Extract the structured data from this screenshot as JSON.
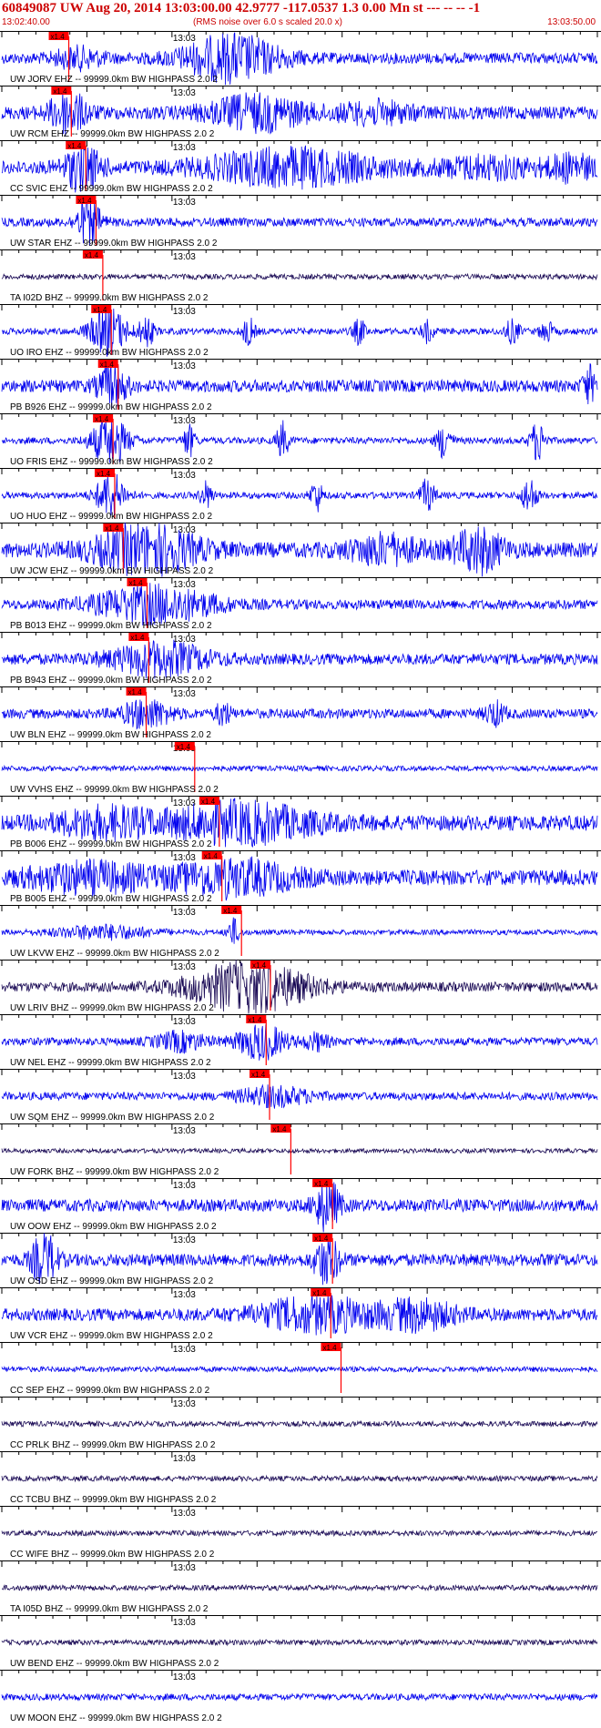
{
  "header": {
    "title": "60849087 UW Aug 20, 2014 13:03:00.00   42.9777 -117.0537  1.3 0.00 Mn st --- -- --   -1",
    "start_time": "13:02:40.00",
    "note": "(RMS noise over 6.0 s scaled 20.0 x)",
    "end_time": "13:03:50.00"
  },
  "colors": {
    "trace": "#0000ee",
    "trace_dark": "#1a0a55",
    "pick": "#ff0000",
    "label": "#000000",
    "header": "#cc0000"
  },
  "chart_data": {
    "type": "line",
    "title": "60849087 UW Aug 20, 2014 13:03:00.00   42.9777 -117.0537  1.3 0.00 Mn st --- -- --   -1",
    "x_start": "13:02:40.00",
    "x_end": "13:03:50.00",
    "xlim": [
      0,
      70
    ],
    "minute_mark": {
      "label": "13:03",
      "t": 20
    },
    "pick_label": "x1.4",
    "series": [
      {
        "name": "UW JORV EHZ -- 99999.0km BW  HIGHPASS  2.0  2",
        "pick": 6.8,
        "amp": 0.25,
        "dark": false,
        "bursts": [
          [
            27,
            4,
            1.0
          ],
          [
            9,
            2,
            0.4
          ]
        ]
      },
      {
        "name": "UW RCM EHZ -- 99999.0km BW  HIGHPASS  2.0  2",
        "pick": 7.1,
        "amp": 0.3,
        "dark": false,
        "bursts": [
          [
            7.8,
            1.5,
            0.9
          ],
          [
            30,
            4,
            0.7
          ],
          [
            44,
            3,
            0.4
          ]
        ]
      },
      {
        "name": "CC SVIC EHZ -- 99999.0km BW  HIGHPASS  2.0  2",
        "pick": 8.8,
        "amp": 0.3,
        "dark": false,
        "bursts": [
          [
            9.5,
            1.5,
            1.0
          ],
          [
            34,
            7,
            0.75
          ],
          [
            57,
            4,
            0.4
          ],
          [
            67,
            2,
            0.5
          ]
        ]
      },
      {
        "name": "UW STAR EHZ -- 99999.0km BW  HIGHPASS  2.0  2",
        "pick": 10.0,
        "amp": 0.2,
        "dark": false,
        "bursts": [
          [
            10.2,
            1.0,
            1.0
          ]
        ]
      },
      {
        "name": "TA I02D BHZ -- 99999.0km BW  HIGHPASS  2.0  2",
        "pick": 10.8,
        "amp": 0.12,
        "dark": true,
        "bursts": []
      },
      {
        "name": "UO IRO EHZ -- 99999.0km BW  HIGHPASS  2.0  2",
        "pick": 11.8,
        "amp": 0.15,
        "dark": false,
        "bursts": [
          [
            12.5,
            1.5,
            1.1
          ],
          [
            17,
            0.6,
            0.7
          ],
          [
            29,
            0.5,
            0.6
          ],
          [
            42,
            0.5,
            0.55
          ],
          [
            50,
            0.5,
            0.45
          ],
          [
            60,
            0.6,
            0.5
          ],
          [
            64,
            0.5,
            0.5
          ]
        ]
      },
      {
        "name": "PB B926 EHZ -- 99999.0km BW  HIGHPASS  2.0  2",
        "pick": 12.6,
        "amp": 0.28,
        "dark": false,
        "bursts": [
          [
            13.0,
            1.2,
            0.9
          ],
          [
            69,
            0.5,
            0.8
          ]
        ]
      },
      {
        "name": "UO FRIS EHZ -- 99999.0km BW  HIGHPASS  2.0  2",
        "pick": 12.0,
        "amp": 0.15,
        "dark": false,
        "bursts": [
          [
            12.7,
            1.5,
            1.1
          ],
          [
            22,
            0.5,
            0.7
          ],
          [
            33,
            0.5,
            0.8
          ],
          [
            52,
            0.6,
            0.8
          ],
          [
            63,
            0.6,
            0.9
          ]
        ]
      },
      {
        "name": "UO HUO EHZ -- 99999.0km BW  HIGHPASS  2.0  2",
        "pick": 12.2,
        "amp": 0.15,
        "dark": false,
        "bursts": [
          [
            12.8,
            1.2,
            1.0
          ],
          [
            24,
            0.5,
            0.6
          ],
          [
            37,
            0.5,
            0.7
          ],
          [
            50,
            0.6,
            0.7
          ],
          [
            62,
            0.6,
            0.8
          ]
        ]
      },
      {
        "name": "UW JCW EHZ -- 99999.0km BW  HIGHPASS  2.0  2",
        "pick": 13.2,
        "amp": 0.35,
        "dark": false,
        "bursts": [
          [
            17,
            4,
            1.1
          ],
          [
            45,
            3,
            0.55
          ],
          [
            56,
            2,
            0.9
          ]
        ]
      },
      {
        "name": "PB B013 EHZ -- 99999.0km BW  HIGHPASS  2.0  2",
        "pick": 16.0,
        "amp": 0.22,
        "dark": false,
        "bursts": [
          [
            18,
            5,
            0.8
          ]
        ]
      },
      {
        "name": "PB B943 EHZ -- 99999.0km BW  HIGHPASS  2.0  2",
        "pick": 16.2,
        "amp": 0.25,
        "dark": false,
        "bursts": [
          [
            18.5,
            4,
            0.7
          ]
        ]
      },
      {
        "name": "UW BLN EHZ -- 99999.0km BW  HIGHPASS  2.0  2",
        "pick": 15.9,
        "amp": 0.22,
        "dark": false,
        "bursts": [
          [
            17,
            2,
            0.6
          ],
          [
            26,
            0.6,
            0.5
          ],
          [
            58,
            0.8,
            0.5
          ]
        ]
      },
      {
        "name": "UW VVHS EHZ -- 99999.0km BW  HIGHPASS  2.0  2",
        "pick": 21.6,
        "amp": 0.12,
        "dark": false,
        "bursts": []
      },
      {
        "name": "PB B006 EHZ -- 99999.0km BW  HIGHPASS  2.0  2",
        "pick": 24.5,
        "amp": 0.35,
        "dark": false,
        "bursts": [
          [
            28,
            6,
            0.8
          ],
          [
            12,
            4,
            0.55
          ]
        ]
      },
      {
        "name": "PB B005 EHZ -- 99999.0km BW  HIGHPASS  2.0  2",
        "pick": 24.8,
        "amp": 0.35,
        "dark": false,
        "bursts": [
          [
            27,
            5,
            0.7
          ],
          [
            10,
            5,
            0.55
          ]
        ]
      },
      {
        "name": "UW LKVW EHZ -- 99999.0km BW  HIGHPASS  2.0  2",
        "pick": 27.1,
        "amp": 0.12,
        "dark": false,
        "bursts": [
          [
            27.2,
            0.5,
            0.6
          ],
          [
            12,
            4,
            0.3
          ]
        ]
      },
      {
        "name": "UW LRIV BHZ -- 99999.0km BW  HIGHPASS  2.0  2",
        "pick": 30.5,
        "amp": 0.22,
        "dark": true,
        "bursts": [
          [
            29,
            5,
            1.1
          ]
        ]
      },
      {
        "name": "UW NEL EHZ -- 99999.0km BW  HIGHPASS  2.0  2",
        "pick": 30.0,
        "amp": 0.18,
        "dark": false,
        "bursts": [
          [
            30.5,
            2,
            0.75
          ],
          [
            21,
            2,
            0.4
          ],
          [
            37,
            1,
            0.35
          ]
        ]
      },
      {
        "name": "UW SQM EHZ -- 99999.0km BW  HIGHPASS  2.0  2",
        "pick": 30.4,
        "amp": 0.18,
        "dark": false,
        "bursts": [
          [
            32,
            3,
            0.4
          ]
        ]
      },
      {
        "name": "UW FORK BHZ -- 99999.0km BW  HIGHPASS  2.0  2",
        "pick": 32.9,
        "amp": 0.1,
        "dark": true,
        "bursts": []
      },
      {
        "name": "UW OOW EHZ -- 99999.0km BW  HIGHPASS  2.0  2",
        "pick": 37.8,
        "amp": 0.28,
        "dark": false,
        "bursts": [
          [
            38.2,
            1,
            1.2
          ]
        ]
      },
      {
        "name": "UW OSD EHZ -- 99999.0km BW  HIGHPASS  2.0  2",
        "pick": 37.8,
        "amp": 0.28,
        "dark": false,
        "bursts": [
          [
            5,
            1,
            1.2
          ],
          [
            38.2,
            1,
            1.1
          ]
        ]
      },
      {
        "name": "UW VCR EHZ -- 99999.0km BW  HIGHPASS  2.0  2",
        "pick": 37.6,
        "amp": 0.28,
        "dark": false,
        "bursts": [
          [
            37,
            5,
            0.7
          ],
          [
            49,
            3,
            0.6
          ]
        ]
      },
      {
        "name": "CC SEP EHZ -- 99999.0km BW  HIGHPASS  2.0  2",
        "pick": 38.8,
        "amp": 0.12,
        "dark": false,
        "bursts": []
      },
      {
        "name": "CC PRLK BHZ -- 99999.0km BW  HIGHPASS  2.0  2",
        "pick": null,
        "amp": 0.12,
        "dark": true,
        "bursts": []
      },
      {
        "name": "CC TCBU BHZ -- 99999.0km BW  HIGHPASS  2.0  2",
        "pick": null,
        "amp": 0.12,
        "dark": true,
        "bursts": []
      },
      {
        "name": "CC WIFE BHZ -- 99999.0km BW  HIGHPASS  2.0  2",
        "pick": null,
        "amp": 0.12,
        "dark": true,
        "bursts": []
      },
      {
        "name": "TA I05D BHZ -- 99999.0km BW  HIGHPASS  2.0  2",
        "pick": null,
        "amp": 0.12,
        "dark": true,
        "bursts": []
      },
      {
        "name": "UW BEND EHZ -- 99999.0km BW  HIGHPASS  2.0  2",
        "pick": null,
        "amp": 0.12,
        "dark": true,
        "bursts": []
      },
      {
        "name": "UW MOON EHZ -- 99999.0km BW  HIGHPASS  2.0  2",
        "pick": null,
        "amp": 0.15,
        "dark": false,
        "bursts": []
      }
    ]
  }
}
